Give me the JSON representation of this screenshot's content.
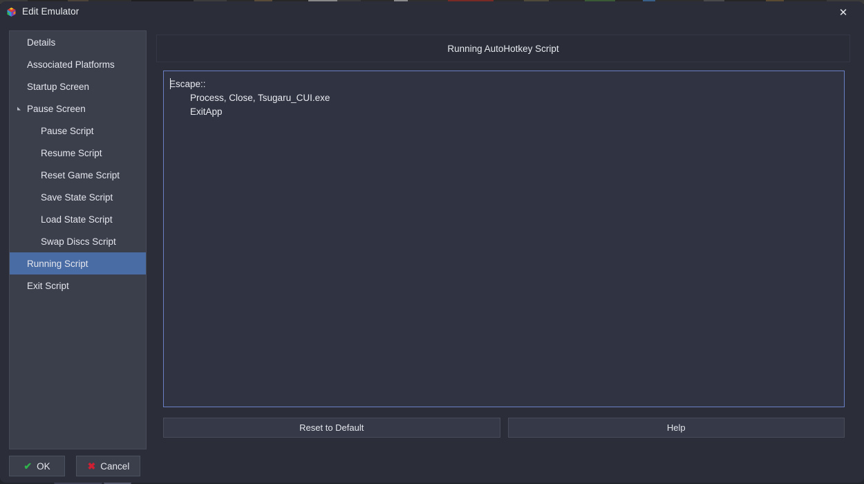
{
  "window": {
    "title": "Edit Emulator",
    "app_icon": "cube-icon",
    "close_label": "✕"
  },
  "sidebar": {
    "items": [
      {
        "label": "Details",
        "level": 0,
        "selected": false,
        "arrow": false
      },
      {
        "label": "Associated Platforms",
        "level": 0,
        "selected": false,
        "arrow": false
      },
      {
        "label": "Startup Screen",
        "level": 0,
        "selected": false,
        "arrow": false
      },
      {
        "label": "Pause Screen",
        "level": 0,
        "selected": false,
        "arrow": true
      },
      {
        "label": "Pause Script",
        "level": 1,
        "selected": false,
        "arrow": false
      },
      {
        "label": "Resume Script",
        "level": 1,
        "selected": false,
        "arrow": false
      },
      {
        "label": "Reset Game Script",
        "level": 1,
        "selected": false,
        "arrow": false
      },
      {
        "label": "Save State Script",
        "level": 1,
        "selected": false,
        "arrow": false
      },
      {
        "label": "Load State Script",
        "level": 1,
        "selected": false,
        "arrow": false
      },
      {
        "label": "Swap Discs Script",
        "level": 1,
        "selected": false,
        "arrow": false
      },
      {
        "label": "Running Script",
        "level": 0,
        "selected": true,
        "arrow": false
      },
      {
        "label": "Exit Script",
        "level": 0,
        "selected": false,
        "arrow": false
      }
    ],
    "selected_label": "Running Script",
    "selection_color": "#4a6ca5"
  },
  "footer": {
    "ok_label": "OK",
    "ok_icon": "check-icon",
    "ok_icon_glyph": "✔",
    "ok_icon_color": "#2fb34a",
    "cancel_label": "Cancel",
    "cancel_icon": "cross-icon",
    "cancel_icon_glyph": "✖",
    "cancel_icon_color": "#cf2033"
  },
  "main": {
    "header_title": "Running AutoHotkey Script",
    "editor": {
      "focus_border_color": "#6b7fc4",
      "background_color": "#303442",
      "caret_visible": true,
      "lines": [
        "Escape::",
        "        Process, Close, Tsugaru_CUI.exe",
        "        ExitApp"
      ]
    },
    "actions": {
      "reset_label": "Reset to Default",
      "help_label": "Help"
    }
  },
  "background_strip": [
    {
      "color": "#3a3a3a",
      "width": 40
    },
    {
      "color": "#262626",
      "width": 58
    },
    {
      "color": "#4b4338",
      "width": 30
    },
    {
      "color": "#2e2e2e",
      "width": 62
    },
    {
      "color": "#1f1f22",
      "width": 90
    },
    {
      "color": "#3c3c3c",
      "width": 48
    },
    {
      "color": "#2a2a2a",
      "width": 40
    },
    {
      "color": "#5a4a38",
      "width": 26
    },
    {
      "color": "#272727",
      "width": 52
    },
    {
      "color": "#888888",
      "width": 42
    },
    {
      "color": "#3a3a3a",
      "width": 34
    },
    {
      "color": "#2b2b2b",
      "width": 48
    },
    {
      "color": "#8b8b8b",
      "width": 20
    },
    {
      "color": "#2f2f2f",
      "width": 58
    },
    {
      "color": "#7a2a24",
      "width": 66
    },
    {
      "color": "#2b2b2b",
      "width": 44
    },
    {
      "color": "#4f4a3a",
      "width": 36
    },
    {
      "color": "#2a2a2a",
      "width": 52
    },
    {
      "color": "#3a5a36",
      "width": 44
    },
    {
      "color": "#272727",
      "width": 40
    },
    {
      "color": "#3a5f86",
      "width": 18
    },
    {
      "color": "#2e2e2e",
      "width": 70
    },
    {
      "color": "#4a4a4a",
      "width": 30
    },
    {
      "color": "#252525",
      "width": 60
    },
    {
      "color": "#5a4a32",
      "width": 26
    },
    {
      "color": "#2a2a2a",
      "width": 62
    },
    {
      "color": "#3a3a3a",
      "width": 54
    }
  ]
}
